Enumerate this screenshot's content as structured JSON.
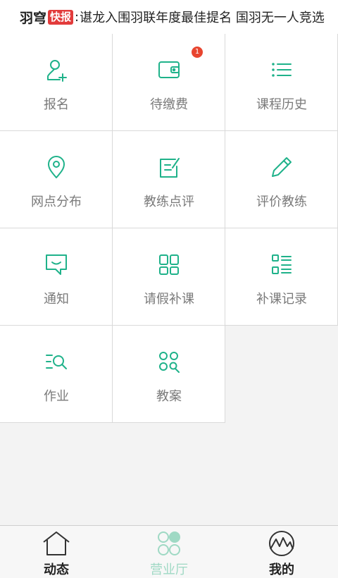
{
  "news": {
    "brand": "羽穹",
    "tag": "快报",
    "headline": "谌龙入围羽联年度最佳提名 国羽无一人竞选"
  },
  "colors": {
    "accent": "#1fb28a",
    "badge": "#e8452f",
    "tab_active": "#9fd9c4"
  },
  "grid": [
    {
      "label": "报名",
      "icon": "person-add-icon"
    },
    {
      "label": "待缴费",
      "icon": "wallet-icon",
      "badge": "1"
    },
    {
      "label": "课程历史",
      "icon": "list-icon"
    },
    {
      "label": "网点分布",
      "icon": "location-pin-icon"
    },
    {
      "label": "教练点评",
      "icon": "edit-note-icon"
    },
    {
      "label": "评价教练",
      "icon": "pencil-icon"
    },
    {
      "label": "通知",
      "icon": "chat-icon"
    },
    {
      "label": "请假补课",
      "icon": "grid-apps-icon"
    },
    {
      "label": "补课记录",
      "icon": "record-list-icon"
    },
    {
      "label": "作业",
      "icon": "search-list-icon"
    },
    {
      "label": "教案",
      "icon": "circles-search-icon"
    }
  ],
  "tabs": [
    {
      "label": "动态",
      "icon": "home-icon",
      "active": false
    },
    {
      "label": "营业厅",
      "icon": "circles-icon",
      "active": true
    },
    {
      "label": "我的",
      "icon": "mountain-icon",
      "active": false
    }
  ]
}
